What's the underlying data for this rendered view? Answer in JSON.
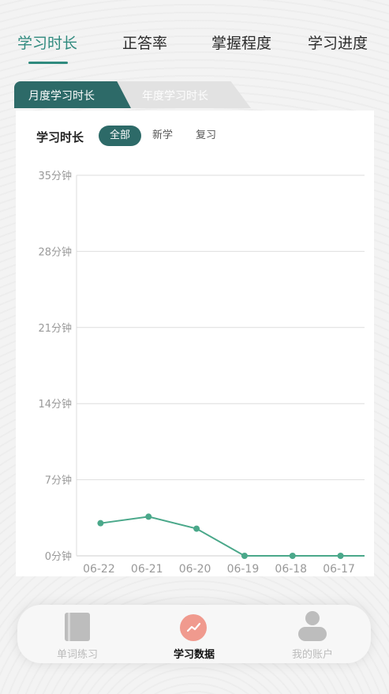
{
  "top_tabs": {
    "items": [
      {
        "label": "学习时长",
        "active": true
      },
      {
        "label": "正答率"
      },
      {
        "label": "掌握程度"
      },
      {
        "label": "学习进度"
      }
    ]
  },
  "segment": {
    "items": [
      {
        "label": "月度学习时长",
        "active": true
      },
      {
        "label": "年度学习时长"
      }
    ]
  },
  "card": {
    "title": "学习时长",
    "filters": [
      {
        "label": "全部",
        "active": true
      },
      {
        "label": "新学"
      },
      {
        "label": "复习"
      }
    ]
  },
  "chart_data": {
    "type": "line",
    "title": "",
    "xlabel": "",
    "ylabel": "",
    "categories": [
      "06-22",
      "06-21",
      "06-20",
      "06-19",
      "06-18",
      "06-17"
    ],
    "y_ticks": [
      "35分钟",
      "28分钟",
      "21分钟",
      "14分钟",
      "7分钟",
      "0分钟"
    ],
    "ylim": [
      0,
      35
    ],
    "grid": true,
    "series": [
      {
        "values": [
          3.0,
          3.6,
          2.5,
          0,
          0,
          0
        ],
        "color": "#4aa88a"
      }
    ]
  },
  "nav": {
    "items": [
      {
        "label": "单词练习",
        "icon": "book-icon"
      },
      {
        "label": "学习数据",
        "icon": "chart-icon",
        "active": true
      },
      {
        "label": "我的账户",
        "icon": "user-icon"
      }
    ]
  },
  "colors": {
    "accent": "#2f8a7e",
    "dark_teal": "#2d6a68",
    "line": "#4aa88a",
    "nav_active_icon": "#f09a8e"
  }
}
